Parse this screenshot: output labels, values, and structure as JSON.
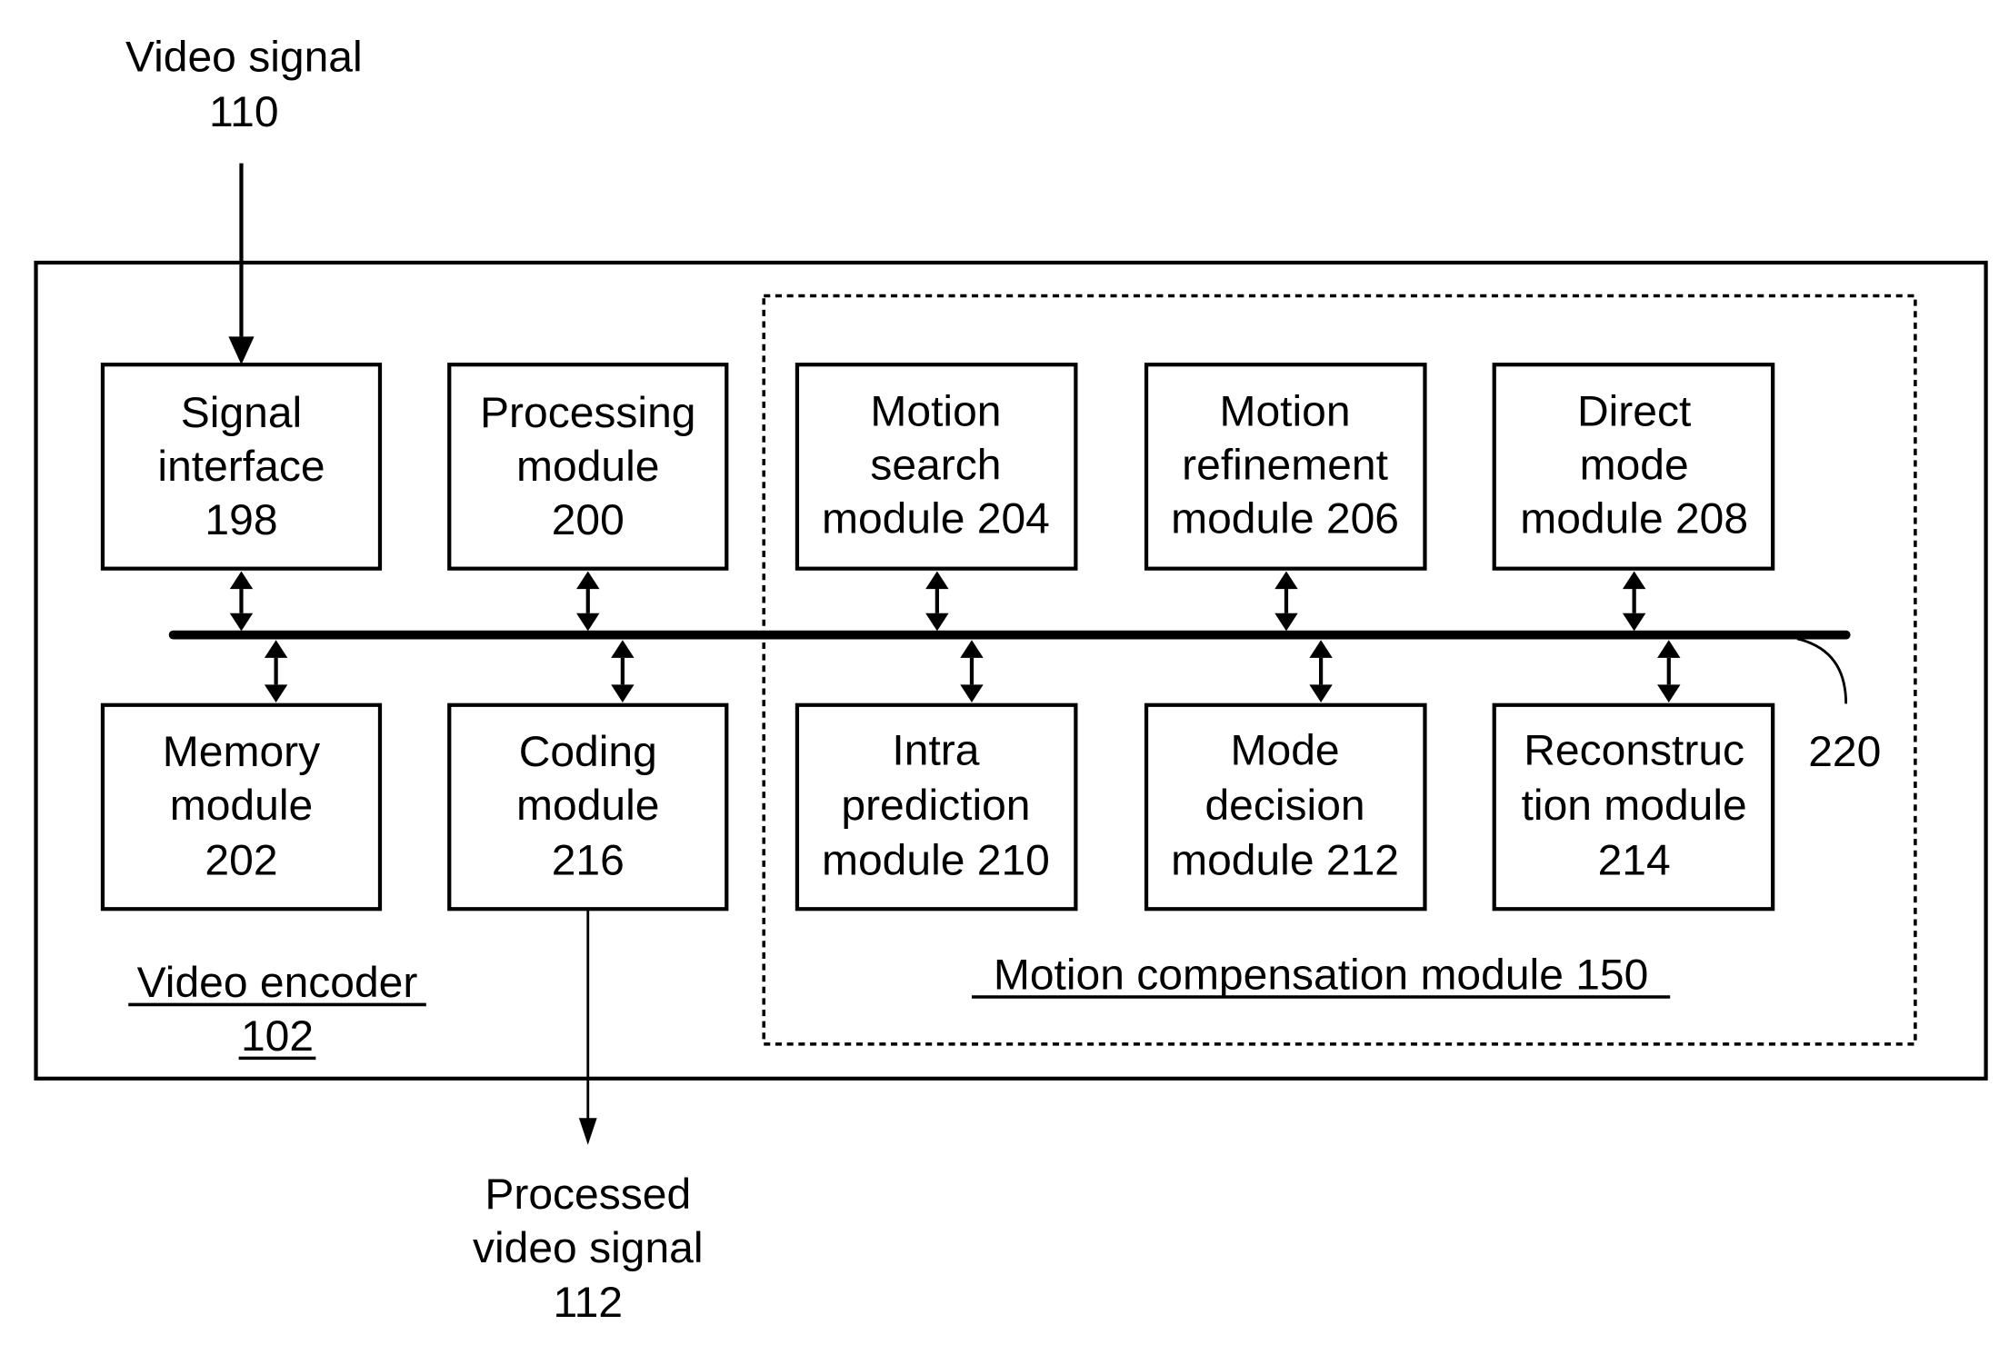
{
  "diagram": {
    "input_signal": {
      "line1": "Video signal",
      "line2": "110"
    },
    "output_signal": {
      "line1": "Processed",
      "line2": "video signal",
      "line3": "112"
    },
    "encoder_label": {
      "line1": "Video encoder",
      "line2": "102"
    },
    "motion_comp_label": "Motion compensation module 150",
    "bus_label": "220",
    "modules": {
      "signal_interface": [
        "Signal",
        "interface",
        "198"
      ],
      "processing": [
        "Processing",
        "module",
        "200"
      ],
      "motion_search": [
        "Motion",
        "search",
        "module 204"
      ],
      "motion_refinement": [
        "Motion",
        "refinement",
        "module 206"
      ],
      "direct_mode": [
        "Direct",
        "mode",
        "module 208"
      ],
      "memory": [
        "Memory",
        "module",
        "202"
      ],
      "coding": [
        "Coding",
        "module",
        "216"
      ],
      "intra_prediction": [
        "Intra",
        "prediction",
        "module 210"
      ],
      "mode_decision": [
        "Mode",
        "decision",
        "module 212"
      ],
      "reconstruction": [
        "Reconstruc",
        "tion module",
        "214"
      ]
    }
  }
}
